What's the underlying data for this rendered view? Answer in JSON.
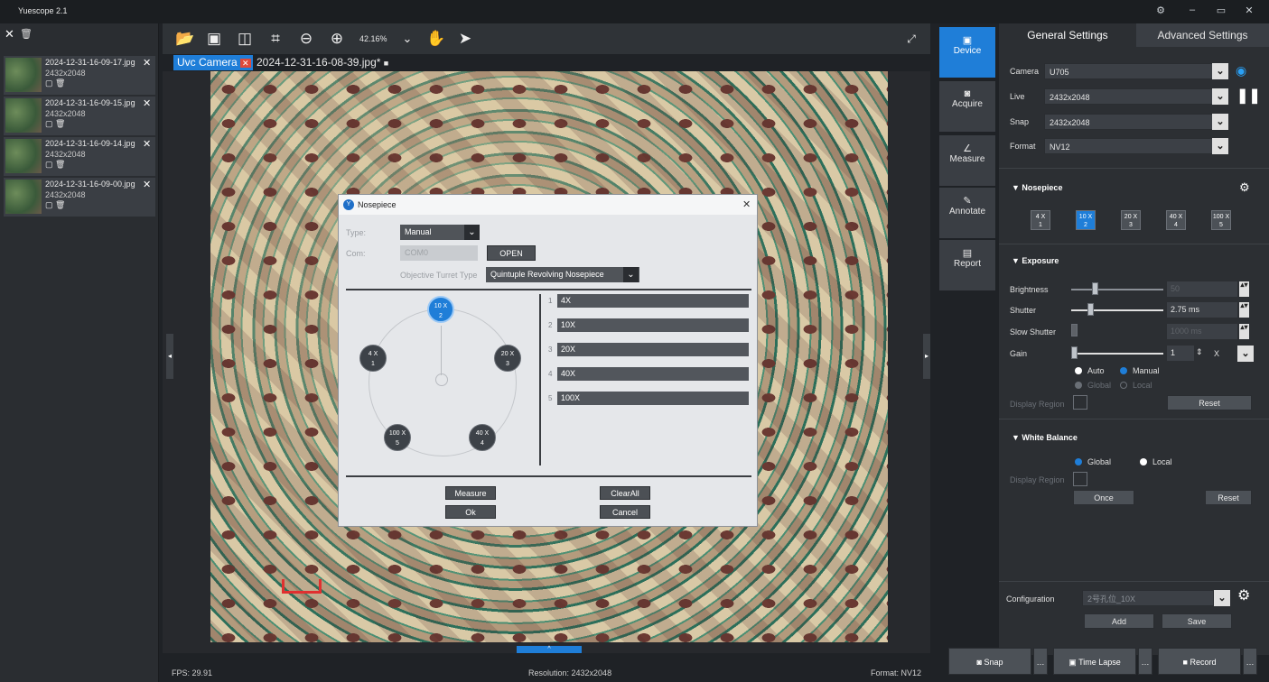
{
  "app": {
    "title": "Yuescope 2.1"
  },
  "left_panel": {
    "thumbs": [
      {
        "name": "2024-12-31-16-09-17.jpg",
        "res": "2432x2048"
      },
      {
        "name": "2024-12-31-16-09-15.jpg",
        "res": "2432x2048"
      },
      {
        "name": "2024-12-31-16-09-14.jpg",
        "res": "2432x2048"
      },
      {
        "name": "2024-12-31-16-09-00.jpg",
        "res": "2432x2048"
      }
    ]
  },
  "toolbar": {
    "zoom": "42.16%"
  },
  "tabs": [
    {
      "label": "Uvc Camera"
    },
    {
      "label": "2024-12-31-16-08-39.jpg*"
    }
  ],
  "status": {
    "fps": "FPS: 29.91",
    "resolution": "Resolution: 2432x2048",
    "format": "Format: NV12"
  },
  "dialog": {
    "title": "Nosepiece",
    "type_label": "Type:",
    "type_value": "Manual",
    "com_label": "Com:",
    "com_value": "COM0",
    "open_button": "OPEN",
    "turret_label": "Objective Turret Type",
    "turret_value": "Quintuple Revolving Nosepiece",
    "lenses": [
      {
        "mag": "4 X",
        "pos": "1"
      },
      {
        "mag": "10 X",
        "pos": "2"
      },
      {
        "mag": "20 X",
        "pos": "3"
      },
      {
        "mag": "40 X",
        "pos": "4"
      },
      {
        "mag": "100 X",
        "pos": "5"
      }
    ],
    "rows": [
      {
        "num": "1",
        "value": "4X"
      },
      {
        "num": "2",
        "value": "10X"
      },
      {
        "num": "3",
        "value": "20X"
      },
      {
        "num": "4",
        "value": "40X"
      },
      {
        "num": "5",
        "value": "100X"
      }
    ],
    "measure": "Measure",
    "clearall": "ClearAll",
    "ok": "Ok",
    "cancel": "Cancel"
  },
  "side_tabs": [
    "Device",
    "Acquire",
    "Measure",
    "Annotate",
    "Report"
  ],
  "right_panel": {
    "tabs": [
      "General Settings",
      "Advanced Settings"
    ],
    "camera_label": "Camera",
    "camera_value": "U705",
    "live_label": "Live",
    "live_value": "2432x2048",
    "snap_label": "Snap",
    "snap_value": "2432x2048",
    "format_label": "Format",
    "format_value": "NV12",
    "nosepiece_title": "Nosepiece",
    "np_buttons": [
      {
        "mag": "4 X",
        "pos": "1"
      },
      {
        "mag": "10 X",
        "pos": "2"
      },
      {
        "mag": "20 X",
        "pos": "3"
      },
      {
        "mag": "40 X",
        "pos": "4"
      },
      {
        "mag": "100 X",
        "pos": "5"
      }
    ],
    "exposure_title": "Exposure",
    "brightness_label": "Brightness",
    "brightness_value": "50",
    "shutter_label": "Shutter",
    "shutter_value": "2.75 ms",
    "slow_shutter_label": "Slow Shutter",
    "slow_shutter_value": "1000 ms",
    "gain_label": "Gain",
    "gain_value": "1",
    "gain_unit": "X",
    "auto_label": "Auto",
    "manual_label": "Manual",
    "global_label": "Global",
    "local_label": "Local",
    "display_region_label": "Display Region",
    "reset_label": "Reset",
    "wb_title": "White Balance",
    "wb_global": "Global",
    "wb_local": "Local",
    "wb_display_region": "Display Region",
    "once_label": "Once",
    "wb_reset": "Reset",
    "config_label": "Configuration",
    "config_value": "2号孔位_10X",
    "add_label": "Add",
    "save_label": "Save"
  },
  "bottom": {
    "snap": "Snap",
    "timelapse": "Time Lapse",
    "record": "Record"
  },
  "colors": {
    "accent": "#1f7ed8",
    "bg": "#1f2226",
    "panel": "#2c2f33"
  }
}
